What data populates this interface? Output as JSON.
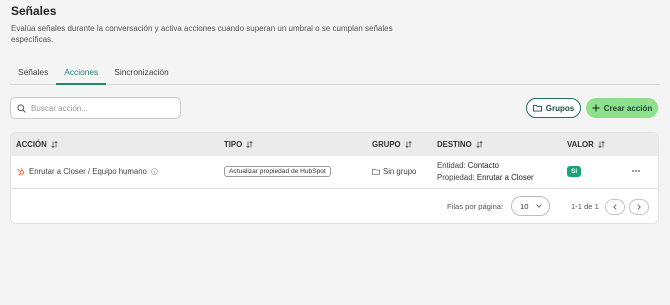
{
  "page": {
    "title": "Señales",
    "description": "Evalúa señales durante la conversación y activa acciones cuando superan un umbral o se cumplan señales específicas."
  },
  "tabs": [
    {
      "label": "Señales",
      "active": false
    },
    {
      "label": "Acciones",
      "active": true
    },
    {
      "label": "Sincronización",
      "active": false
    }
  ],
  "search": {
    "placeholder": "Buscar acción..."
  },
  "toolbar": {
    "groups_label": "Grupos",
    "create_label": "Crear acción"
  },
  "table": {
    "columns": [
      "ACCIÓN",
      "TIPO",
      "GRUPO",
      "DESTINO",
      "VALOR"
    ],
    "rows": [
      {
        "action": "Enrutar a Closer / Equipo humano",
        "type": "Actualizar propiedad de HubSpot",
        "group": "Sin grupo",
        "dest_entity_label": "Entidad:",
        "dest_entity_value": "Contacto",
        "dest_prop_label": "Propiedad:",
        "dest_prop_value": "Enrutar a Closer",
        "value": "Sí"
      }
    ]
  },
  "pagination": {
    "rows_per_page_label": "Filas por página:",
    "rows_per_page": "10",
    "range": "1-1 de 1"
  },
  "colors": {
    "accent": "#1f8a6e",
    "create_button": "#8ee08d",
    "value_badge": "#18a37a",
    "hubspot": "#ff7a59"
  },
  "icons": [
    "search-icon",
    "folder-icon",
    "plus-icon",
    "sort-icon",
    "hubspot-icon",
    "info-icon",
    "more-icon",
    "chevron-down-icon",
    "chevron-left-icon",
    "chevron-right-icon"
  ]
}
